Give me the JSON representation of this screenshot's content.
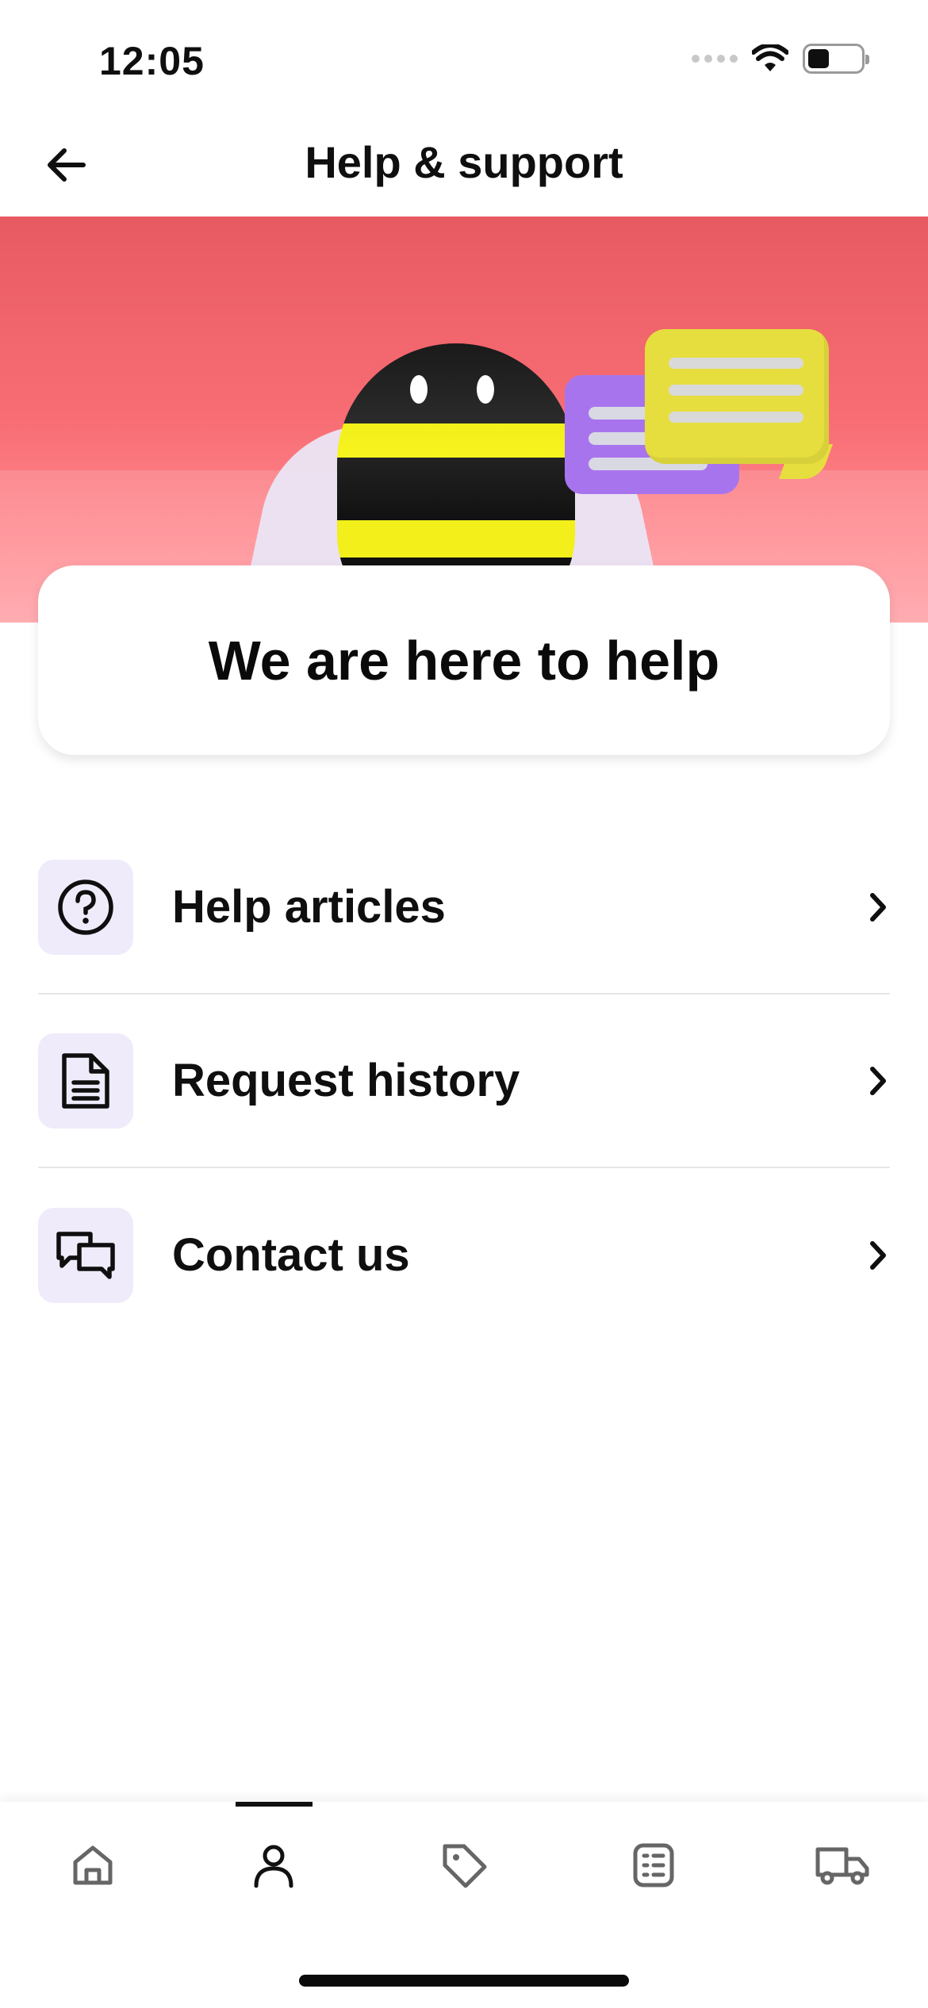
{
  "status_bar": {
    "time": "12:05",
    "icons": [
      "signal-icon",
      "wifi-icon",
      "battery-icon"
    ]
  },
  "header": {
    "title": "Help & support",
    "back_icon": "arrow-left-icon"
  },
  "hero": {
    "card_text": "We are here to help",
    "colors": {
      "banner_top": "#e85a62",
      "banner_bottom": "#ffa0a6"
    }
  },
  "menu": {
    "items": [
      {
        "label": "Help articles",
        "icon": "question-circle-icon"
      },
      {
        "label": "Request history",
        "icon": "document-icon"
      },
      {
        "label": "Contact us",
        "icon": "chat-bubbles-icon"
      }
    ],
    "icon_bg": "#efebfb"
  },
  "bottom_nav": {
    "items": [
      {
        "name": "home",
        "icon": "home-icon",
        "active": false
      },
      {
        "name": "account",
        "icon": "person-icon",
        "active": true
      },
      {
        "name": "offers",
        "icon": "tag-icon",
        "active": false
      },
      {
        "name": "orders",
        "icon": "list-icon",
        "active": false
      },
      {
        "name": "delivery",
        "icon": "truck-icon",
        "active": false
      }
    ]
  }
}
